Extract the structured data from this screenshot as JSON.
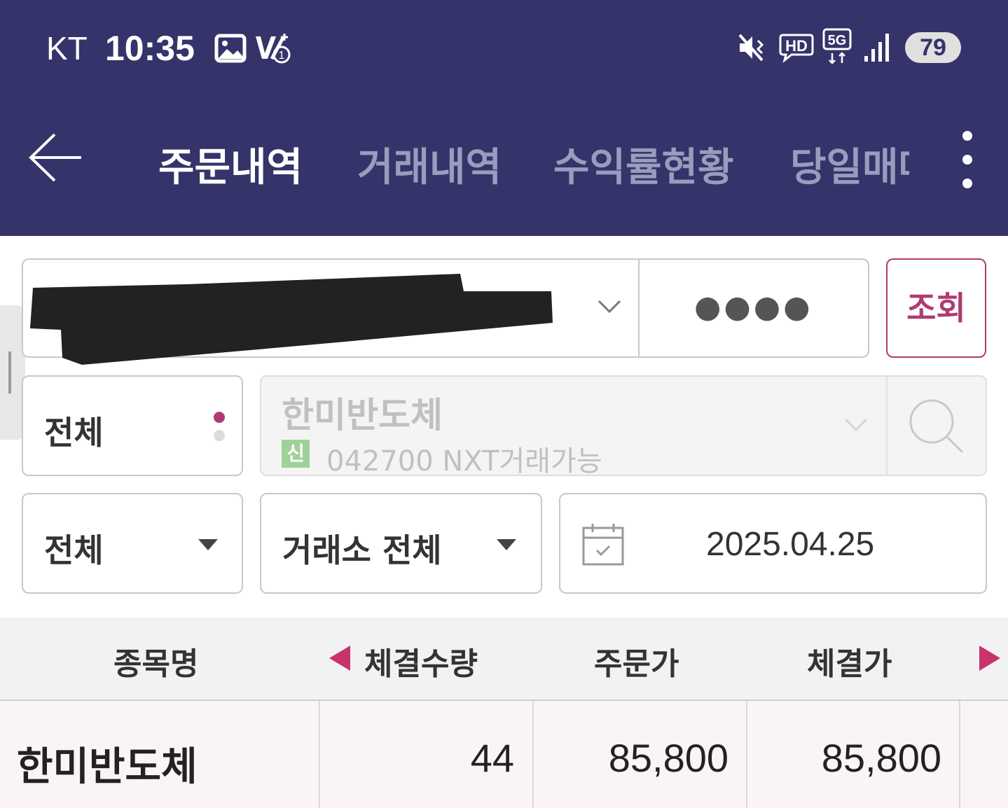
{
  "status_bar": {
    "carrier": "KT",
    "time": "10:35",
    "battery": "79",
    "icons": [
      "gallery-icon",
      "volte-icon",
      "mute-vibrate-icon",
      "hd-voice-icon",
      "5g-icon",
      "signal-icon"
    ]
  },
  "nav": {
    "tabs": [
      {
        "label": "주문내역",
        "active": true
      },
      {
        "label": "거래내역",
        "active": false
      },
      {
        "label": "수익률현황",
        "active": false
      },
      {
        "label": "당일매매",
        "active": false
      }
    ]
  },
  "account": {
    "password_mask": "●●●●",
    "search_label": "조회"
  },
  "filter": {
    "order_type": "전체",
    "stock_name": "한미반도체",
    "stock_badge": "신",
    "stock_code_info": "042700 NXT거래가능",
    "trade_type": "전체",
    "exchange": "거래소 전체",
    "date": "2025.04.25"
  },
  "table": {
    "headers": [
      "종목명",
      "체결수량",
      "주문가",
      "체결가"
    ],
    "rows": [
      {
        "name": "한미반도체",
        "qty": "44",
        "order_price": "85,800",
        "exec_price": "85,800"
      }
    ]
  },
  "colors": {
    "header_bg": "#34336a",
    "accent": "#b03a72"
  }
}
